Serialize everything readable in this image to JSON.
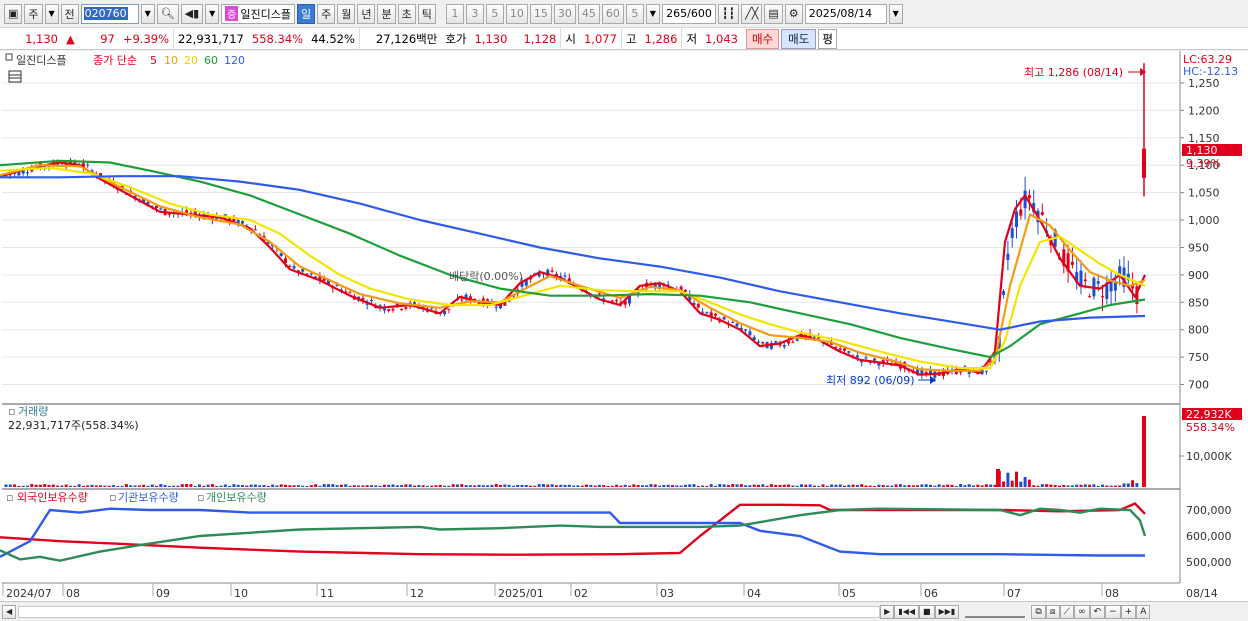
{
  "toolbar": {
    "market_type": "주",
    "prev_label": "전",
    "stock_code": "020760",
    "stock_tag": "증",
    "stock_name": "일진디스플",
    "period_tabs": [
      "일",
      "주",
      "월",
      "년",
      "분",
      "초",
      "틱"
    ],
    "period_selected": "일",
    "interval_buttons": [
      "1",
      "3",
      "5",
      "10",
      "15",
      "30",
      "45",
      "60"
    ],
    "interval_value": "5",
    "bar_count": "265",
    "bar_total": "/600",
    "date": "2025/08/14"
  },
  "quote": {
    "price": "1,130",
    "arrow": "▲",
    "change": "97",
    "change_pct": "+9.39%",
    "volume": "22,931,717",
    "volume_ratio": "558.34%",
    "turnover": "44.52%",
    "amount": "27,126백만",
    "hoga_label": "호가",
    "ask": "1,130",
    "bid": "1,128",
    "open_label": "시",
    "open": "1,077",
    "high_label": "고",
    "high": "1,286",
    "low_label": "저",
    "low": "1,043",
    "buy_label": "매수",
    "sell_label": "매도",
    "avg_label": "평"
  },
  "price_panel": {
    "legend_name": "일진디스플",
    "legend_ma_prefix": "종가 단순",
    "ma_periods": [
      "5",
      "10",
      "20",
      "60",
      "120"
    ],
    "ma_colors": [
      "#e0001b",
      "#f39c12",
      "#f2e600",
      "#1e9e3a",
      "#2f5bea"
    ],
    "lc_label": "LC:63.29",
    "hc_label": "HC:-12.13",
    "high_marker": "최고 1,286 (08/14)",
    "low_marker": "최저 892 (06/09)",
    "dividend_label": "배당락(0.00%)",
    "current_price_tag": "1,130",
    "current_pct_tag": "9.39%"
  },
  "volume_panel": {
    "title": "거래량",
    "value_text": "22,931,717주(558.34%)",
    "tag_value": "22,932K",
    "tag_pct": "558.34%",
    "axis_label": "10,000K"
  },
  "holder_panel": {
    "legend": [
      "외국인보유수량",
      "기관보유수량",
      "개인보유수량"
    ],
    "legend_colors": [
      "#e0001b",
      "#2f5bea",
      "#2e8b57"
    ],
    "axis_labels": [
      "700,000",
      "600,000",
      "500,000"
    ]
  },
  "x_axis": {
    "labels": [
      "2024/07",
      "08",
      "09",
      "10",
      "11",
      "12",
      "2025/01",
      "02",
      "03",
      "04",
      "05",
      "06",
      "07",
      "08"
    ],
    "right_label": "08/14"
  },
  "chart_data": {
    "type": "line",
    "title": "",
    "y_ticks": [
      1250,
      1200,
      1150,
      1100,
      1050,
      1000,
      950,
      900,
      850,
      800,
      750,
      700
    ],
    "ylim": [
      670,
      1290
    ],
    "series": [
      {
        "name": "5",
        "points": [
          [
            0,
            1080
          ],
          [
            30,
            1095
          ],
          [
            60,
            1105
          ],
          [
            80,
            1100
          ],
          [
            100,
            1075
          ],
          [
            130,
            1045
          ],
          [
            160,
            1015
          ],
          [
            190,
            1010
          ],
          [
            220,
            1005
          ],
          [
            250,
            985
          ],
          [
            270,
            950
          ],
          [
            290,
            910
          ],
          [
            320,
            890
          ],
          [
            350,
            862
          ],
          [
            380,
            840
          ],
          [
            410,
            845
          ],
          [
            440,
            830
          ],
          [
            460,
            860
          ],
          [
            480,
            850
          ],
          [
            500,
            845
          ],
          [
            520,
            885
          ],
          [
            540,
            905
          ],
          [
            560,
            895
          ],
          [
            580,
            875
          ],
          [
            600,
            855
          ],
          [
            620,
            845
          ],
          [
            640,
            880
          ],
          [
            660,
            885
          ],
          [
            680,
            870
          ],
          [
            700,
            830
          ],
          [
            720,
            818
          ],
          [
            740,
            800
          ],
          [
            760,
            770
          ],
          [
            780,
            775
          ],
          [
            800,
            790
          ],
          [
            820,
            780
          ],
          [
            840,
            760
          ],
          [
            860,
            745
          ],
          [
            880,
            740
          ],
          [
            900,
            735
          ],
          [
            920,
            718
          ],
          [
            940,
            720
          ],
          [
            960,
            728
          ],
          [
            980,
            722
          ],
          [
            995,
            760
          ],
          [
            1005,
            960
          ],
          [
            1015,
            1020
          ],
          [
            1025,
            1045
          ],
          [
            1040,
            1000
          ],
          [
            1060,
            930
          ],
          [
            1080,
            880
          ],
          [
            1100,
            875
          ],
          [
            1120,
            900
          ],
          [
            1135,
            860
          ],
          [
            1145,
            900
          ]
        ]
      },
      {
        "name": "10",
        "points": [
          [
            0,
            1082
          ],
          [
            40,
            1100
          ],
          [
            80,
            1098
          ],
          [
            120,
            1060
          ],
          [
            160,
            1025
          ],
          [
            200,
            1005
          ],
          [
            240,
            992
          ],
          [
            270,
            960
          ],
          [
            300,
            915
          ],
          [
            330,
            890
          ],
          [
            360,
            865
          ],
          [
            400,
            848
          ],
          [
            440,
            840
          ],
          [
            470,
            852
          ],
          [
            500,
            850
          ],
          [
            520,
            870
          ],
          [
            550,
            898
          ],
          [
            580,
            880
          ],
          [
            620,
            858
          ],
          [
            650,
            878
          ],
          [
            680,
            872
          ],
          [
            710,
            840
          ],
          [
            740,
            812
          ],
          [
            770,
            790
          ],
          [
            800,
            785
          ],
          [
            830,
            778
          ],
          [
            860,
            758
          ],
          [
            890,
            745
          ],
          [
            920,
            728
          ],
          [
            950,
            725
          ],
          [
            980,
            725
          ],
          [
            995,
            745
          ],
          [
            1010,
            880
          ],
          [
            1030,
            1010
          ],
          [
            1050,
            990
          ],
          [
            1070,
            945
          ],
          [
            1090,
            905
          ],
          [
            1110,
            890
          ],
          [
            1130,
            880
          ],
          [
            1145,
            890
          ]
        ]
      },
      {
        "name": "20",
        "points": [
          [
            0,
            1090
          ],
          [
            50,
            1095
          ],
          [
            90,
            1085
          ],
          [
            130,
            1060
          ],
          [
            170,
            1030
          ],
          [
            210,
            1010
          ],
          [
            250,
            1000
          ],
          [
            280,
            975
          ],
          [
            310,
            935
          ],
          [
            340,
            900
          ],
          [
            370,
            875
          ],
          [
            410,
            855
          ],
          [
            450,
            845
          ],
          [
            490,
            845
          ],
          [
            520,
            860
          ],
          [
            560,
            880
          ],
          [
            600,
            872
          ],
          [
            640,
            870
          ],
          [
            680,
            870
          ],
          [
            710,
            850
          ],
          [
            740,
            828
          ],
          [
            770,
            810
          ],
          [
            800,
            795
          ],
          [
            840,
            780
          ],
          [
            880,
            760
          ],
          [
            920,
            742
          ],
          [
            960,
            730
          ],
          [
            990,
            730
          ],
          [
            1005,
            780
          ],
          [
            1020,
            880
          ],
          [
            1040,
            960
          ],
          [
            1060,
            970
          ],
          [
            1080,
            945
          ],
          [
            1100,
            920
          ],
          [
            1120,
            900
          ],
          [
            1145,
            880
          ]
        ]
      },
      {
        "name": "60",
        "points": [
          [
            0,
            1100
          ],
          [
            60,
            1108
          ],
          [
            110,
            1105
          ],
          [
            150,
            1090
          ],
          [
            200,
            1070
          ],
          [
            250,
            1045
          ],
          [
            300,
            1010
          ],
          [
            350,
            975
          ],
          [
            400,
            935
          ],
          [
            450,
            900
          ],
          [
            500,
            875
          ],
          [
            550,
            862
          ],
          [
            600,
            862
          ],
          [
            650,
            865
          ],
          [
            700,
            862
          ],
          [
            750,
            850
          ],
          [
            800,
            830
          ],
          [
            850,
            810
          ],
          [
            900,
            785
          ],
          [
            950,
            765
          ],
          [
            990,
            750
          ],
          [
            1010,
            770
          ],
          [
            1040,
            810
          ],
          [
            1080,
            830
          ],
          [
            1110,
            845
          ],
          [
            1145,
            855
          ]
        ]
      },
      {
        "name": "120",
        "points": [
          [
            0,
            1078
          ],
          [
            60,
            1078
          ],
          [
            120,
            1080
          ],
          [
            180,
            1080
          ],
          [
            240,
            1070
          ],
          [
            300,
            1055
          ],
          [
            360,
            1030
          ],
          [
            420,
            1000
          ],
          [
            480,
            975
          ],
          [
            540,
            950
          ],
          [
            600,
            930
          ],
          [
            660,
            915
          ],
          [
            720,
            895
          ],
          [
            780,
            870
          ],
          [
            840,
            850
          ],
          [
            900,
            830
          ],
          [
            960,
            812
          ],
          [
            1000,
            800
          ],
          [
            1040,
            815
          ],
          [
            1090,
            822
          ],
          [
            1145,
            825
          ]
        ]
      }
    ]
  }
}
